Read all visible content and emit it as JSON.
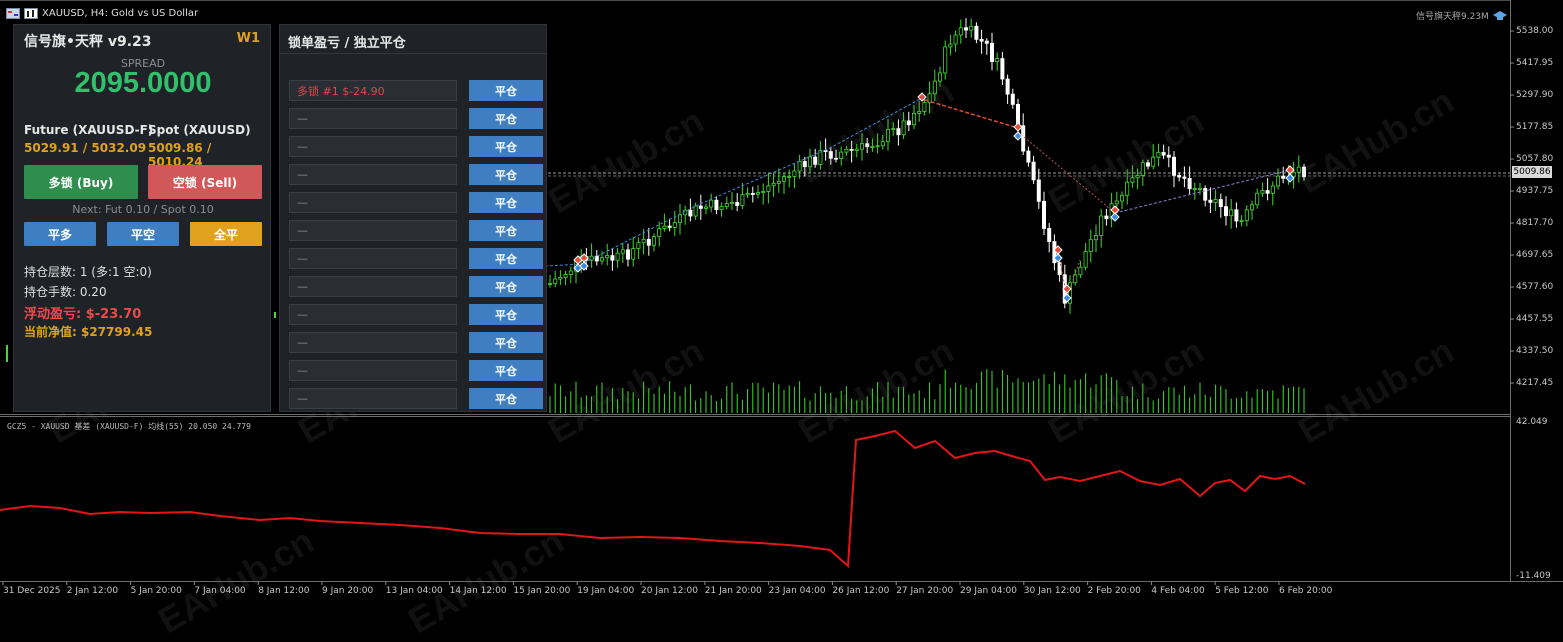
{
  "window": {
    "symbol_title": "XAUUSD, H4:  Gold vs US Dollar",
    "ea_label": "信号旗天秤9.23M"
  },
  "left_panel": {
    "title": "信号旗•天秤 v9.23",
    "timeframe": "W1",
    "spread_label": "SPREAD",
    "spread_value": "2095.0000",
    "future_header": "Future (XAUUSD-F)",
    "spot_header": "Spot (XAUUSD)",
    "future_quote": "5029.91 / 5032.09",
    "spot_quote": "5009.86 / 5010.24",
    "buy_button": "多锁 (Buy)",
    "sell_button": "空锁 (Sell)",
    "next_lot": "Next: Fut 0.10 / Spot 0.10",
    "close_long": "平多",
    "close_short": "平空",
    "close_all": "全平",
    "layers": "持仓层数: 1 (多:1 空:0)",
    "lots": "持仓手数: 0.20",
    "floating_pl": "浮动盈亏: $-23.70",
    "equity": "当前净值: $27799.45"
  },
  "mid_panel": {
    "title": "锁单盈亏 / 独立平仓",
    "rows": [
      {
        "label": "多锁 #1  $-24.90",
        "button": "平仓"
      },
      {
        "label": "—",
        "button": "平仓"
      },
      {
        "label": "—",
        "button": "平仓"
      },
      {
        "label": "—",
        "button": "平仓"
      },
      {
        "label": "—",
        "button": "平仓"
      },
      {
        "label": "—",
        "button": "平仓"
      },
      {
        "label": "—",
        "button": "平仓"
      },
      {
        "label": "—",
        "button": "平仓"
      },
      {
        "label": "—",
        "button": "平仓"
      },
      {
        "label": "—",
        "button": "平仓"
      },
      {
        "label": "—",
        "button": "平仓"
      },
      {
        "label": "—",
        "button": "平仓"
      }
    ]
  },
  "price_axis": [
    "5538.00",
    "5417.95",
    "5297.90",
    "5177.85",
    "5057.80",
    "4937.75",
    "4817.70",
    "4697.65",
    "4577.60",
    "4457.55",
    "4337.50",
    "4217.45"
  ],
  "current_price": "5009.86",
  "indicator": {
    "title": "GCZ5 - XAUUSD 基差 (XAUUSD-F) 均线(55) 20.050 24.779",
    "max_label": "42.049",
    "min_label": "-11.409"
  },
  "time_axis": [
    "31 Dec 2025",
    "2 Jan 12:00",
    "5 Jan 20:00",
    "7 Jan 04:00",
    "8 Jan 12:00",
    "9 Jan 20:00",
    "13 Jan 04:00",
    "14 Jan 12:00",
    "15 Jan 20:00",
    "19 Jan 04:00",
    "20 Jan 12:00",
    "21 Jan 20:00",
    "23 Jan 04:00",
    "26 Jan 12:00",
    "27 Jan 20:00",
    "29 Jan 04:00",
    "30 Jan 12:00",
    "2 Feb 20:00",
    "4 Feb 04:00",
    "5 Feb 12:00",
    "6 Feb 20:00"
  ],
  "watermark": "EAHub.cn",
  "colors": {
    "bull": "#3fdc2a",
    "bear": "#ffffff",
    "indicator": "#e31515",
    "buy": "#2f8d4e",
    "sell": "#d05858",
    "blue_button": "#3f7fc1",
    "gold_button": "#e0a21c"
  }
}
